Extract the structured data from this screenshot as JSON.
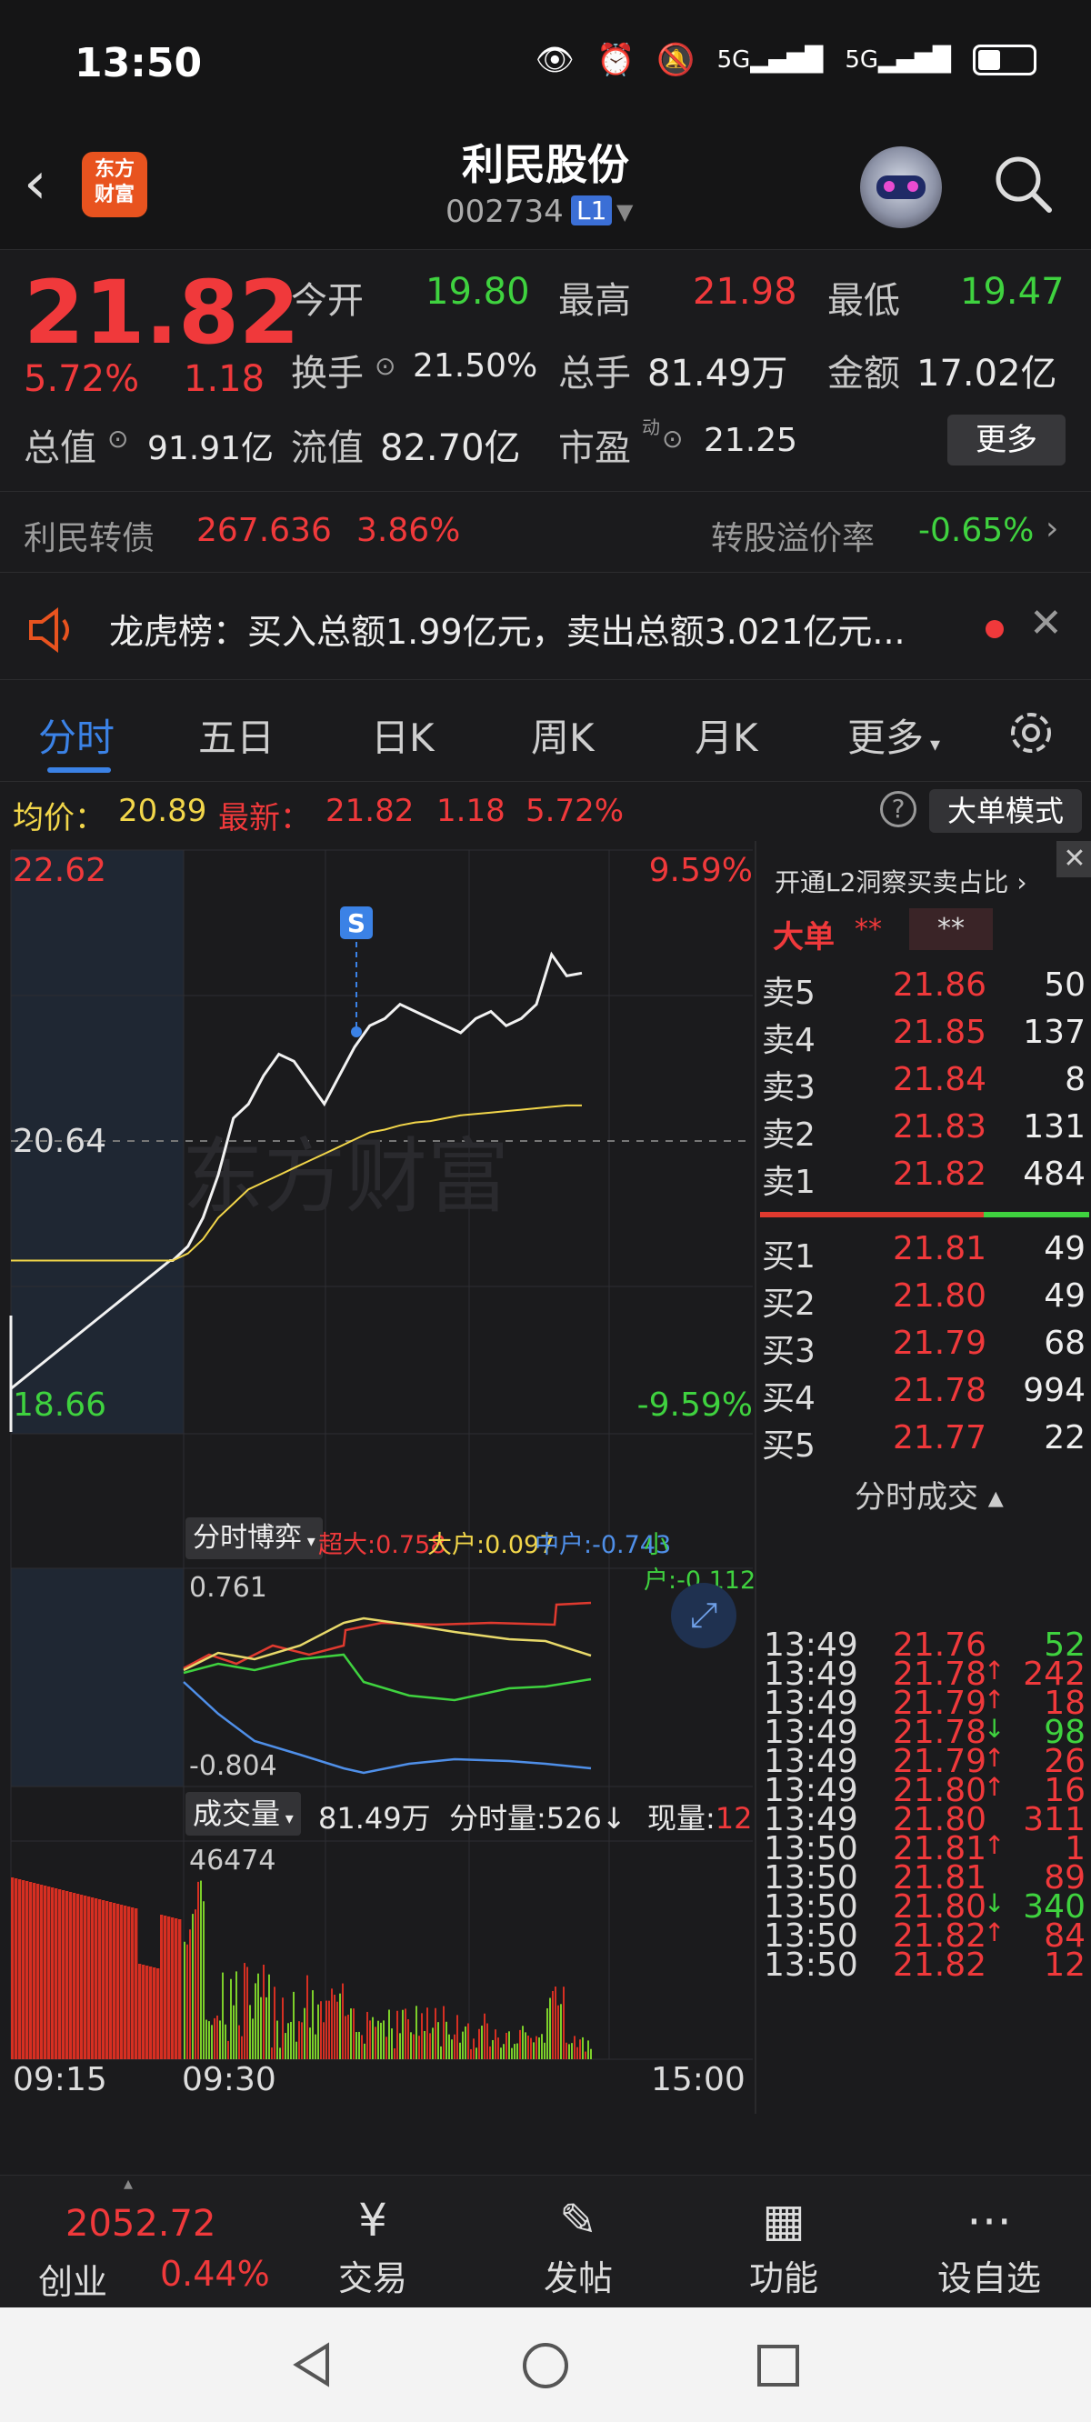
{
  "status_bar": {
    "time": "13:50",
    "net1": "5G",
    "net2": "5G"
  },
  "header": {
    "logo_text": "东方财富",
    "name": "利民股份",
    "code": "002734",
    "level": "L1"
  },
  "quote": {
    "price": "21.82",
    "change_pct": "5.72%",
    "change": "1.18",
    "open_label": "今开",
    "open": "19.80",
    "high_label": "最高",
    "high": "21.98",
    "low_label": "最低",
    "low": "19.47",
    "turnover_label": "换手",
    "turnover": "21.50%",
    "volume_label": "总手",
    "volume": "81.49万",
    "amount_label": "金额",
    "amount": "17.02亿",
    "mktcap_label": "总值",
    "mktcap": "91.91亿",
    "float_label": "流值",
    "float": "82.70亿",
    "pe_label": "市盈",
    "pe_sup": "动",
    "pe": "21.25",
    "more_label": "更多"
  },
  "bond": {
    "name": "利民转债",
    "price": "267.636",
    "pct": "3.86%",
    "premium_label": "转股溢价率",
    "premium": "-0.65%"
  },
  "notice": {
    "text": "龙虎榜：买入总额1.99亿元，卖出总额3.021亿元..."
  },
  "tabs": [
    "分时",
    "五日",
    "日K",
    "周K",
    "月K",
    "更多"
  ],
  "avg_row": {
    "avg_label": "均价：",
    "avg": "20.89",
    "latest_label": "最新：",
    "latest": "21.82",
    "chg": "1.18",
    "pct": "5.72%",
    "big_mode": "大单模式"
  },
  "chart_labels": {
    "price_high": "22.62",
    "pct_high": "9.59%",
    "price_mid": "20.64",
    "price_low": "18.66",
    "pct_low": "-9.59%",
    "s_marker": "S",
    "flow_selector": "分时博弈",
    "flow_super": "超大:0.758",
    "flow_big": "大户:0.097",
    "flow_mid": "中户:-0.743",
    "flow_small": "小户:-0.112",
    "flow_top": "0.761",
    "flow_bottom": "-0.804",
    "vol_selector": "成交量",
    "vol_total": "81.49万",
    "vol_minute": "分时量:526↓",
    "vol_now_label": "现量:",
    "vol_now": "12",
    "vol_max": "46474",
    "t_start": "09:15",
    "t_open": "09:30",
    "t_end": "15:00",
    "watermark": "东方财富"
  },
  "chart_data": {
    "type": "line",
    "ylim": [
      18.66,
      22.62
    ],
    "x": [
      "09:15",
      "09:25",
      "09:30",
      "09:31",
      "09:32",
      "09:33",
      "09:35",
      "09:38",
      "09:41",
      "09:45",
      "09:50",
      "09:55",
      "10:00",
      "10:05",
      "10:10",
      "10:20",
      "10:30",
      "10:40",
      "10:50",
      "11:00",
      "11:10",
      "11:20",
      "11:30",
      "13:00",
      "13:10",
      "13:20",
      "13:30",
      "13:40",
      "13:45",
      "13:50"
    ],
    "series": [
      {
        "name": "price",
        "values": [
          18.9,
          19.8,
          19.8,
          19.9,
          20.1,
          20.4,
          20.8,
          20.9,
          21.1,
          21.25,
          21.2,
          21.05,
          20.9,
          21.1,
          21.3,
          21.45,
          21.5,
          21.6,
          21.55,
          21.5,
          21.45,
          21.4,
          21.5,
          21.55,
          21.45,
          21.5,
          21.6,
          21.95,
          21.8,
          21.82
        ]
      },
      {
        "name": "avg",
        "values": [
          19.8,
          19.8,
          19.8,
          19.85,
          19.95,
          20.1,
          20.2,
          20.3,
          20.35,
          20.4,
          20.45,
          20.5,
          20.55,
          20.6,
          20.65,
          20.7,
          20.72,
          20.75,
          20.77,
          20.78,
          20.8,
          20.82,
          20.83,
          20.84,
          20.85,
          20.86,
          20.87,
          20.88,
          20.89,
          20.89
        ]
      }
    ]
  },
  "order_book": {
    "link_text": "开通L2洞察买卖占比",
    "big_label": "大单",
    "big_a": "**",
    "big_b": "**",
    "asks": [
      {
        "label": "卖5",
        "price": "21.86",
        "vol": "50"
      },
      {
        "label": "卖4",
        "price": "21.85",
        "vol": "137"
      },
      {
        "label": "卖3",
        "price": "21.84",
        "vol": "8"
      },
      {
        "label": "卖2",
        "price": "21.83",
        "vol": "131"
      },
      {
        "label": "卖1",
        "price": "21.82",
        "vol": "484"
      }
    ],
    "bids": [
      {
        "label": "买1",
        "price": "21.81",
        "vol": "49"
      },
      {
        "label": "买2",
        "price": "21.80",
        "vol": "49"
      },
      {
        "label": "买3",
        "price": "21.79",
        "vol": "68"
      },
      {
        "label": "买4",
        "price": "21.78",
        "vol": "994"
      },
      {
        "label": "买5",
        "price": "21.77",
        "vol": "22"
      }
    ],
    "ticks_title": "分时成交",
    "ticks": [
      {
        "time": "13:49",
        "price": "21.76",
        "arrow": "",
        "vol": "52",
        "color": "green"
      },
      {
        "time": "13:49",
        "price": "21.78",
        "arrow": "↑",
        "vol": "242",
        "color": "red"
      },
      {
        "time": "13:49",
        "price": "21.79",
        "arrow": "↑",
        "vol": "18",
        "color": "red"
      },
      {
        "time": "13:49",
        "price": "21.78",
        "arrow": "↓",
        "vol": "98",
        "color": "green"
      },
      {
        "time": "13:49",
        "price": "21.79",
        "arrow": "↑",
        "vol": "26",
        "color": "red"
      },
      {
        "time": "13:49",
        "price": "21.80",
        "arrow": "↑",
        "vol": "16",
        "color": "red"
      },
      {
        "time": "13:49",
        "price": "21.80",
        "arrow": "",
        "vol": "311",
        "color": "red"
      },
      {
        "time": "13:50",
        "price": "21.81",
        "arrow": "↑",
        "vol": "1",
        "color": "red"
      },
      {
        "time": "13:50",
        "price": "21.81",
        "arrow": "",
        "vol": "89",
        "color": "red"
      },
      {
        "time": "13:50",
        "price": "21.80",
        "arrow": "↓",
        "vol": "340",
        "color": "green"
      },
      {
        "time": "13:50",
        "price": "21.82",
        "arrow": "↑",
        "vol": "84",
        "color": "red"
      },
      {
        "time": "13:50",
        "price": "21.82",
        "arrow": "",
        "vol": "12",
        "color": "red"
      }
    ]
  },
  "bottom_nav": {
    "index_value": "2052.72",
    "index_name": "创业",
    "index_pct": "0.44%",
    "items": [
      {
        "label": "交易",
        "icon": "yen-cycle-icon"
      },
      {
        "label": "发帖",
        "icon": "edit-icon"
      },
      {
        "label": "功能",
        "icon": "grid-icon"
      },
      {
        "label": "设自选",
        "icon": "more-circle-icon"
      }
    ]
  },
  "colors": {
    "up": "#f0393b",
    "down": "#3fd23f",
    "avg": "#f2d64a",
    "accent": "#3b82e6"
  }
}
